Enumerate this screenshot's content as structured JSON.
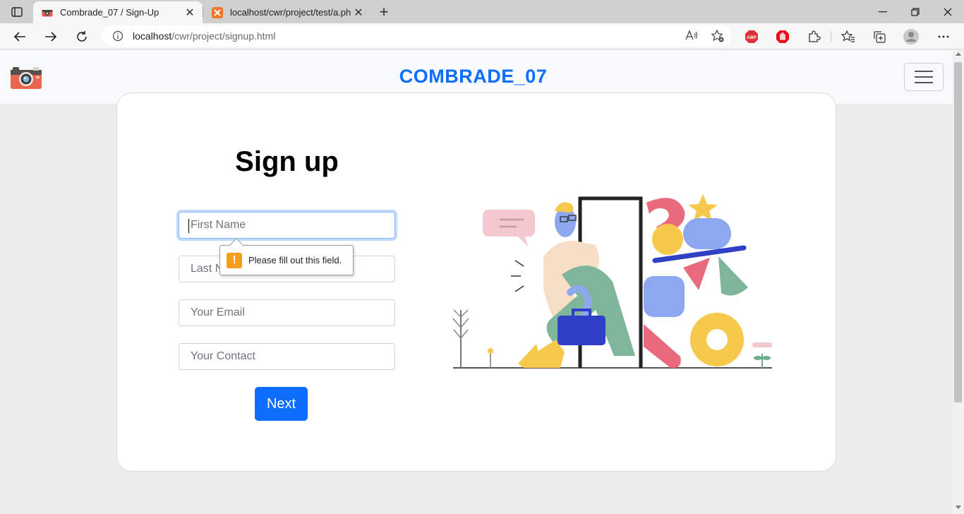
{
  "browser": {
    "tabs": [
      {
        "title": "Combrade_07 / Sign-Up",
        "active": true,
        "icon": "camera-favicon"
      },
      {
        "title": "localhost/cwr/project/test/a.php",
        "active": false,
        "icon": "xampp-favicon"
      }
    ],
    "address_host": "localhost",
    "address_path": "/cwr/project/signup.html",
    "extensions": [
      "abp-icon",
      "stop-hand-icon",
      "puzzle-icon"
    ]
  },
  "site": {
    "brand": "COMBRADE_07",
    "colors": {
      "accent": "#0d6efd",
      "warning": "#f89c1c"
    }
  },
  "form": {
    "heading": "Sign up",
    "first_name_placeholder": "First Name",
    "last_name_placeholder": "Last Name",
    "email_placeholder": "Your Email",
    "contact_placeholder": "Your Contact",
    "next_label": "Next",
    "validation_message": "Please fill out this field."
  }
}
